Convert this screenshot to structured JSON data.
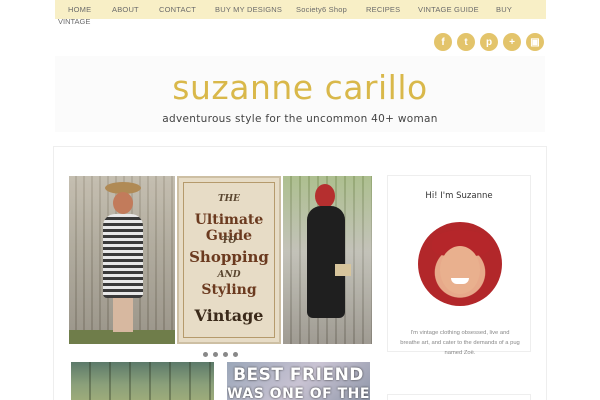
{
  "nav": {
    "items": [
      "HOME",
      "ABOUT",
      "CONTACT",
      "BUY MY DESIGNS",
      "Society6 Shop",
      "RECIPES",
      "VINTAGE GUIDE",
      "BUY"
    ],
    "wrap": "VINTAGE"
  },
  "social": {
    "icons": [
      {
        "name": "facebook-icon",
        "glyph": "f"
      },
      {
        "name": "twitter-icon",
        "glyph": "t"
      },
      {
        "name": "pinterest-icon",
        "glyph": "p"
      },
      {
        "name": "google-plus-icon",
        "glyph": "+"
      },
      {
        "name": "instagram-icon",
        "glyph": "▣"
      }
    ],
    "color": "#e3c46b"
  },
  "header": {
    "title": "suzanne carillo",
    "tagline": "adventurous style for the uncommon 40+ woman"
  },
  "slider": {
    "poster_lines": [
      "THE",
      "Ultimate Guide",
      "TO",
      "Shopping",
      "AND",
      "Styling",
      "Vintage"
    ],
    "slide_count": 4
  },
  "thumbs": {
    "second_lines": [
      "BEST FRIEND",
      "WAS ONE OF THE"
    ]
  },
  "sidebar": {
    "title": "Hi! I'm Suzanne",
    "bio": "I'm vintage clothing obsessed, live and breathe art, and cater to the demands of a pug named Zoë."
  },
  "colors": {
    "accent": "#d9b84a",
    "nav_bg": "#f8efc6"
  }
}
